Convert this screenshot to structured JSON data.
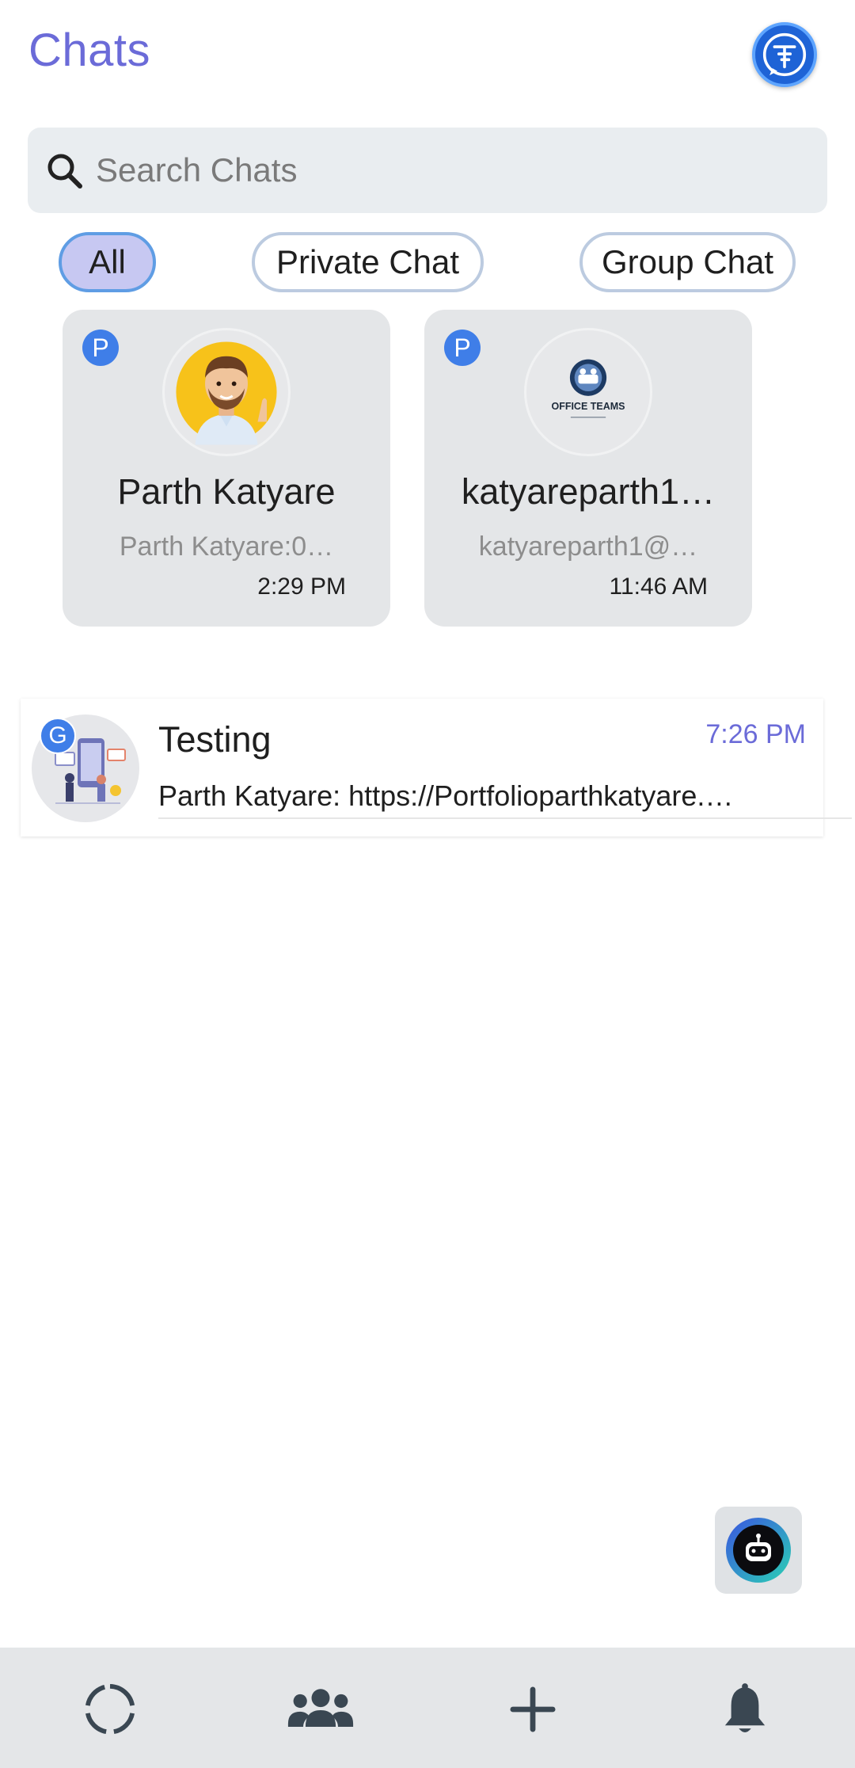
{
  "header": {
    "title": "Chats",
    "logo_icon": "app-logo-icon"
  },
  "search": {
    "placeholder": "Search Chats",
    "icon": "search-icon"
  },
  "filters": [
    {
      "label": "All",
      "active": true
    },
    {
      "label": "Private Chat",
      "active": false
    },
    {
      "label": "Group Chat",
      "active": false
    }
  ],
  "pinned": [
    {
      "badge": "P",
      "name": "Parth Katyare",
      "preview": "Parth Katyare:0…",
      "time": "2:29 PM",
      "avatar": "bitmoji-avatar"
    },
    {
      "badge": "P",
      "name": "katyareparth1…",
      "preview": "katyareparth1@…",
      "time": "11:46 AM",
      "avatar": "office-teams-logo",
      "avatar_caption": "OFFICE TEAMS"
    }
  ],
  "chats": [
    {
      "badge": "G",
      "title": "Testing",
      "time": "7:26 PM",
      "preview": "Parth Katyare: https://Portfolioparthkatyare.…",
      "avatar": "group-illustration"
    }
  ],
  "fab": {
    "icon": "chatbot-icon"
  },
  "bottom_nav": [
    {
      "icon": "status-ring-icon"
    },
    {
      "icon": "people-group-icon"
    },
    {
      "icon": "plus-icon"
    },
    {
      "icon": "bell-icon"
    }
  ],
  "colors": {
    "accent": "#6b6bd8",
    "badge": "#3f7ee8",
    "chip_active": "#c7c8f2",
    "card_bg": "#e4e6e8",
    "search_bg": "#e9edf0"
  }
}
